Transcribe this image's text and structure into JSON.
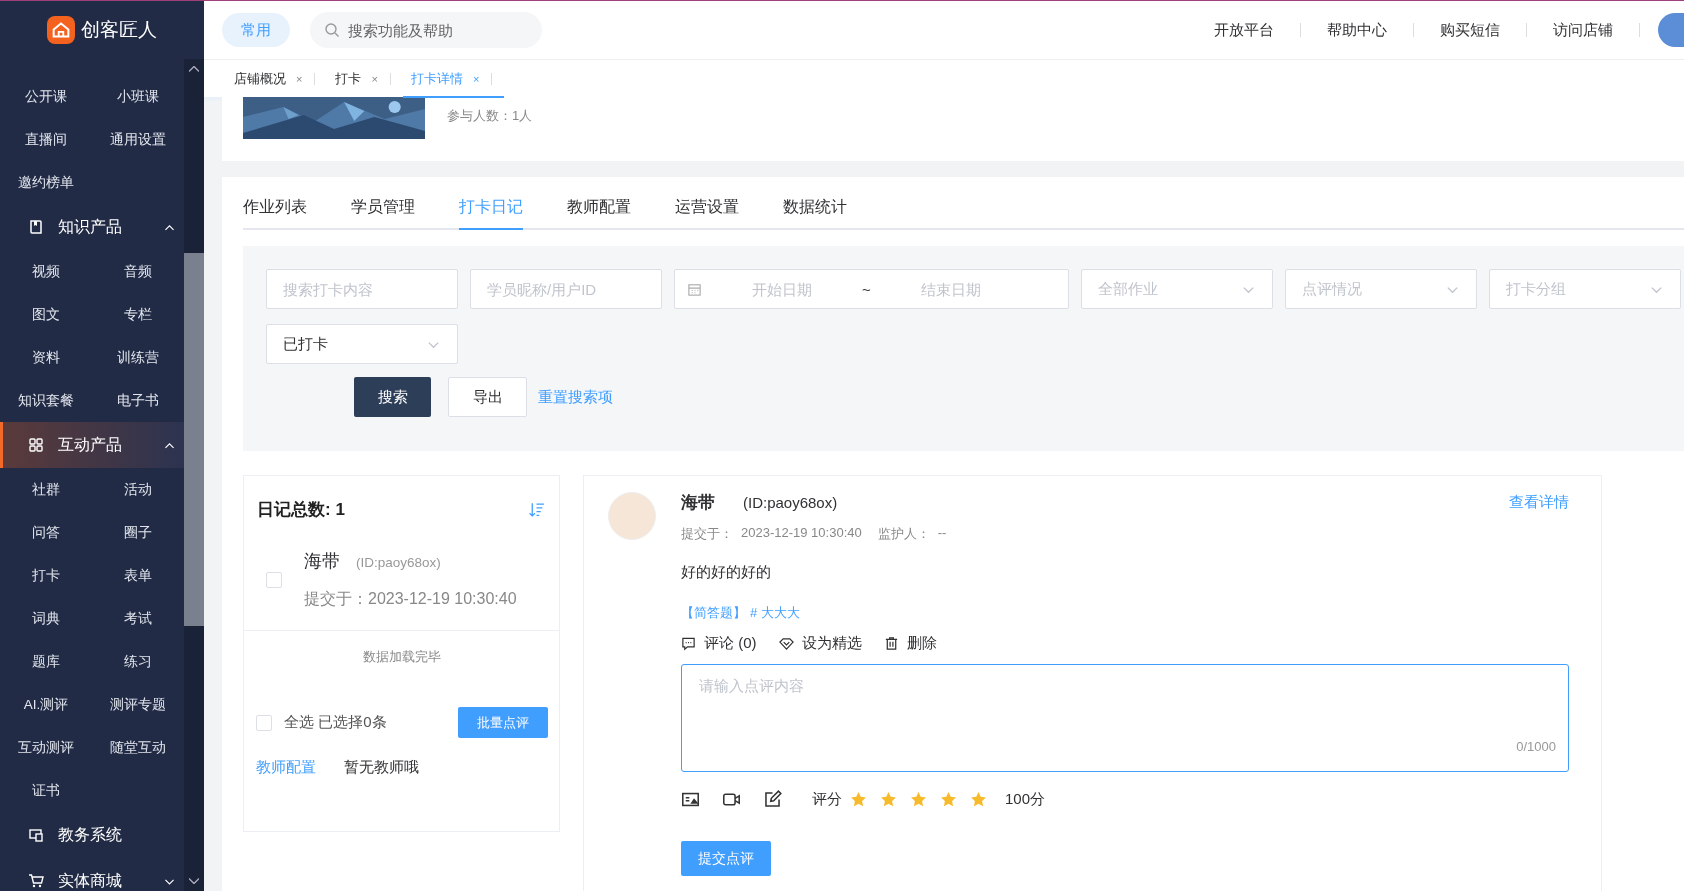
{
  "app": {
    "logo_text": "创客匠人"
  },
  "sidebar": {
    "groups": [
      {
        "kind": "continued",
        "items": [
          "公开课",
          "小班课",
          "直播间",
          "通用设置",
          "邀约榜单"
        ]
      },
      {
        "title": "知识产品",
        "kind": "collapsible",
        "expanded": true,
        "selected": false,
        "items": [
          "视频",
          "音频",
          "图文",
          "专栏",
          "资料",
          "训练营",
          "知识套餐",
          "电子书"
        ]
      },
      {
        "title": "互动产品",
        "kind": "collapsible",
        "expanded": true,
        "selected": true,
        "items": [
          "社群",
          "活动",
          "问答",
          "圈子",
          "打卡",
          "表单",
          "词典",
          "考试",
          "题库",
          "练习",
          "AI.测评",
          "测评专题",
          "互动测评",
          "随堂互动",
          "证书"
        ]
      },
      {
        "title": "教务系统",
        "kind": "link",
        "selected": false
      },
      {
        "title": "实体商城",
        "kind": "collapsible",
        "expanded": false,
        "selected": false
      }
    ]
  },
  "topbar": {
    "quick": "常用",
    "search_placeholder": "搜索功能及帮助",
    "links": [
      "开放平台",
      "帮助中心",
      "购买短信",
      "访问店铺"
    ]
  },
  "page_tabs": [
    {
      "label": "店铺概况",
      "selected": false,
      "close": "×"
    },
    {
      "label": "打卡",
      "selected": false,
      "close": "×"
    },
    {
      "label": "打卡详情",
      "selected": true,
      "close": "×"
    }
  ],
  "overview": {
    "participants": "参与人数：1人"
  },
  "tabs": [
    {
      "label": "作业列表",
      "selected": false
    },
    {
      "label": "学员管理",
      "selected": false
    },
    {
      "label": "打卡日记",
      "selected": true
    },
    {
      "label": "教师配置",
      "selected": false
    },
    {
      "label": "运营设置",
      "selected": false
    },
    {
      "label": "数据统计",
      "selected": false
    }
  ],
  "filters": [
    {
      "kind": "input",
      "placeholder": "搜索打卡内容"
    },
    {
      "kind": "input",
      "placeholder": "学员昵称/用户ID"
    },
    {
      "kind": "daterange",
      "start_placeholder": "开始日期",
      "separator": "~",
      "end_placeholder": "结束日期"
    },
    {
      "kind": "select",
      "placeholder": "全部作业"
    },
    {
      "kind": "select",
      "placeholder": "点评情况"
    },
    {
      "kind": "select",
      "placeholder": "打卡分组"
    },
    {
      "kind": "select",
      "value": "已打卡"
    }
  ],
  "filter_buttons": {
    "search": "搜索",
    "export": "导出",
    "reset": "重置搜索项"
  },
  "diary_list": {
    "title": "日记总数: 1",
    "entries": [
      {
        "name": "海带",
        "id": "(ID:paoy68ox)",
        "submitted": "提交于：2023-12-19 10:30:40",
        "checked": false
      }
    ],
    "footer": "数据加载完毕",
    "select_all": {
      "label": "全选 已选择0条",
      "checked": false
    },
    "batch_button": "批量点评",
    "teacher_link": "教师配置",
    "teacher_text": "暂无教师哦"
  },
  "detail": {
    "name": "海带",
    "id": "(ID:paoy68ox)",
    "submitted_label": "提交于：",
    "submitted": "2023-12-19 10:30:40",
    "guardian_label": "监护人：",
    "guardian": "--",
    "view_link": "查看详情",
    "content": "好的好的好的",
    "question_type": "【简答题】",
    "topic": "# 大大大",
    "actions": [
      {
        "kind": "comment",
        "label": "评论 (0)"
      },
      {
        "kind": "feature",
        "label": "设为精选"
      },
      {
        "kind": "delete",
        "label": "删除"
      }
    ],
    "comment_placeholder": "请输入点评内容",
    "counter": "0/1000",
    "rating_label": "评分",
    "stars": 5,
    "score": "100分",
    "submit": "提交点评"
  }
}
